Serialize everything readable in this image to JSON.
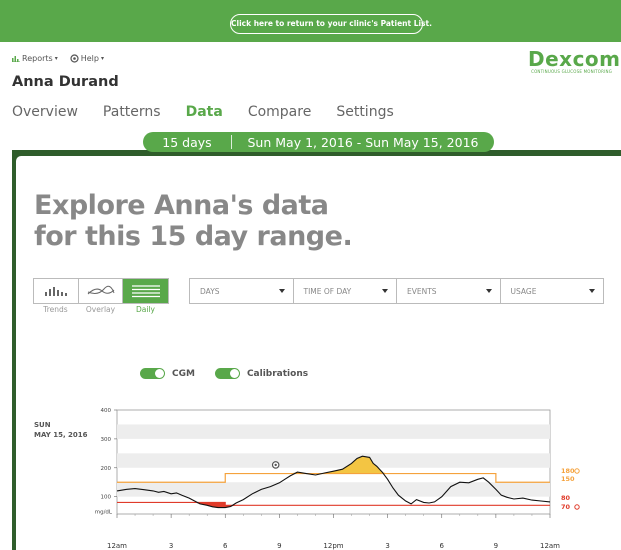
{
  "banner": {
    "return_label": "Click here to return to your clinic's Patient List."
  },
  "menus": {
    "reports": "Reports",
    "help": "Help"
  },
  "logo": {
    "word": "Dexcom",
    "tagline": "CONTINUOUS GLUCOSE MONITORING"
  },
  "patient": {
    "name": "Anna Durand"
  },
  "nav": {
    "tabs": [
      "Overview",
      "Patterns",
      "Data",
      "Compare",
      "Settings"
    ],
    "active": "Data"
  },
  "range": {
    "days": "15 days",
    "dates": "Sun May 1, 2016 - Sun May 15, 2016"
  },
  "headline": {
    "line1": "Explore Anna's data",
    "line2": "for this 15 day range."
  },
  "views": {
    "labels": [
      "Trends",
      "Overlay",
      "Daily"
    ],
    "active": "Daily"
  },
  "filters": [
    "DAYS",
    "TIME OF DAY",
    "EVENTS",
    "USAGE"
  ],
  "toggles": {
    "cgm": "CGM",
    "calibrations": "Calibrations"
  },
  "day": {
    "weekday": "SUN",
    "date": "MAY 15, 2016"
  },
  "colors": {
    "brand_green": "#59a84a",
    "dark_green": "#2f5d2b",
    "target_orange": "#f5a23c",
    "low_red": "#e03b2a",
    "high_yellow": "#f3c543"
  },
  "chart_data": {
    "type": "line",
    "y_unit": "mg/dL",
    "y_ticks": [
      100,
      200,
      300,
      400
    ],
    "ylim": [
      40,
      400
    ],
    "x_tick_labels": [
      "12am",
      "3",
      "6",
      "9",
      "12pm",
      "3",
      "6",
      "9",
      "12am"
    ],
    "xlim_hours": [
      0,
      24
    ],
    "threshold_labels": {
      "high": [
        "180",
        "150"
      ],
      "low": [
        "80",
        "70"
      ]
    },
    "target_high_segments": [
      {
        "from": 0,
        "to": 6,
        "value": 150
      },
      {
        "from": 6,
        "to": 21,
        "value": 180
      },
      {
        "from": 21,
        "to": 24,
        "value": 150
      }
    ],
    "target_low_segments": [
      {
        "from": 0,
        "to": 6,
        "value": 80
      },
      {
        "from": 6,
        "to": 21,
        "value": 70
      },
      {
        "from": 21,
        "to": 24,
        "value": 70
      }
    ],
    "glucose": {
      "x": [
        0,
        0.5,
        1,
        1.5,
        2,
        2.3,
        2.6,
        3,
        3.3,
        3.6,
        4,
        4.3,
        4.6,
        5,
        5.3,
        5.6,
        6,
        6.3,
        6.6,
        7,
        7.5,
        8,
        8.5,
        9,
        9.3,
        9.6,
        10,
        10.5,
        11,
        11.5,
        12,
        12.5,
        13,
        13.3,
        13.6,
        14,
        14.2,
        14.4,
        14.7,
        15,
        15.3,
        15.6,
        16,
        16.3,
        16.6,
        17,
        17.3,
        17.6,
        18,
        18.5,
        19,
        19.5,
        20,
        20.3,
        20.6,
        21,
        21.3,
        21.6,
        22,
        22.5,
        23,
        23.5,
        24
      ],
      "y": [
        120,
        125,
        128,
        124,
        120,
        115,
        118,
        110,
        113,
        105,
        95,
        85,
        75,
        70,
        65,
        62,
        62,
        66,
        78,
        90,
        110,
        125,
        135,
        148,
        160,
        172,
        185,
        180,
        175,
        182,
        188,
        195,
        215,
        232,
        240,
        236,
        215,
        205,
        185,
        160,
        130,
        105,
        85,
        75,
        90,
        80,
        78,
        82,
        100,
        135,
        150,
        148,
        160,
        165,
        150,
        125,
        105,
        98,
        92,
        95,
        88,
        85,
        82
      ]
    },
    "calibration_hours": [
      9.35
    ]
  }
}
